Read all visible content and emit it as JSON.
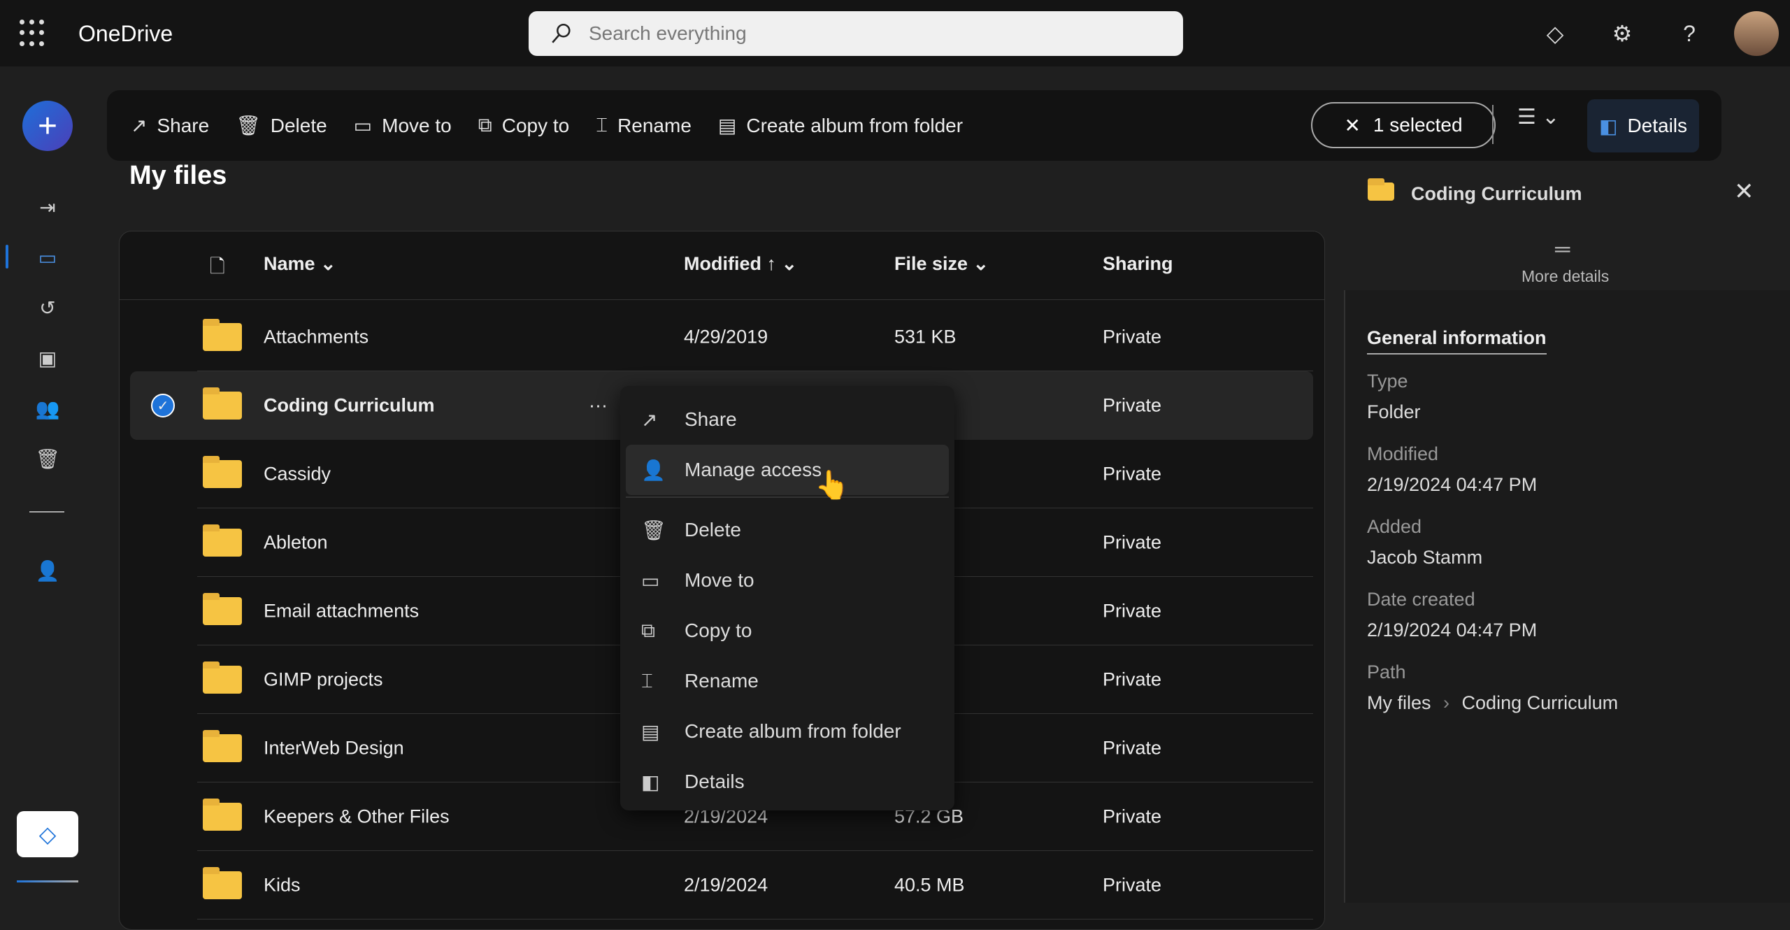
{
  "app": {
    "title": "OneDrive",
    "search_placeholder": "Search everything"
  },
  "header_icons": [
    "premium-diamond-icon",
    "settings-gear-icon",
    "help-icon",
    "avatar"
  ],
  "toolbar": {
    "items": [
      {
        "label": "Share",
        "icon": "share-icon"
      },
      {
        "label": "Delete",
        "icon": "trash-icon"
      },
      {
        "label": "Move to",
        "icon": "move-icon"
      },
      {
        "label": "Copy to",
        "icon": "copy-icon"
      },
      {
        "label": "Rename",
        "icon": "rename-icon"
      },
      {
        "label": "Create album from folder",
        "icon": "album-icon"
      }
    ],
    "selected_label": "1 selected",
    "details_label": "Details"
  },
  "page": {
    "title": "My files"
  },
  "table": {
    "columns": {
      "name": "Name",
      "modified": "Modified",
      "size": "File size",
      "sharing": "Sharing"
    },
    "rows": [
      {
        "name": "Attachments",
        "modified": "4/29/2019",
        "size": "531 KB",
        "sharing": "Private"
      },
      {
        "name": "Coding Curriculum",
        "modified": "",
        "size": "",
        "sharing": "Private",
        "selected": true
      },
      {
        "name": "Cassidy",
        "modified": "",
        "size": "",
        "sharing": "Private"
      },
      {
        "name": "Ableton",
        "modified": "",
        "size": "",
        "sharing": "Private"
      },
      {
        "name": "Email attachments",
        "modified": "",
        "size": "",
        "sharing": "Private"
      },
      {
        "name": "GIMP projects",
        "modified": "",
        "size": "",
        "sharing": "Private"
      },
      {
        "name": "InterWeb Design",
        "modified": "",
        "size": "",
        "sharing": "Private"
      },
      {
        "name": "Keepers & Other Files",
        "modified": "2/19/2024",
        "size": "57.2 GB",
        "sharing": "Private"
      },
      {
        "name": "Kids",
        "modified": "2/19/2024",
        "size": "40.5 MB",
        "sharing": "Private"
      }
    ]
  },
  "context_menu": {
    "items": [
      {
        "label": "Share",
        "icon": "share-icon"
      },
      {
        "label": "Manage access",
        "icon": "manage-access-icon"
      },
      {
        "label": "Delete",
        "icon": "trash-icon"
      },
      {
        "label": "Move to",
        "icon": "move-icon"
      },
      {
        "label": "Copy to",
        "icon": "copy-icon"
      },
      {
        "label": "Rename",
        "icon": "rename-icon"
      },
      {
        "label": "Create album from folder",
        "icon": "album-icon"
      },
      {
        "label": "Details",
        "icon": "details-icon"
      }
    ]
  },
  "details_panel": {
    "title": "Coding Curriculum",
    "more_details": "More details",
    "section": "General information",
    "fields": [
      {
        "label": "Type",
        "value": "Folder"
      },
      {
        "label": "Modified",
        "value": "2/19/2024 04:47 PM"
      },
      {
        "label": "Added",
        "value": "Jacob Stamm"
      },
      {
        "label": "Date created",
        "value": "2/19/2024 04:47 PM"
      },
      {
        "label": "Path",
        "value": "My files",
        "value2": "Coding Curriculum"
      }
    ]
  },
  "colors": {
    "accent": "#1e73d9",
    "folder": "#f6c443",
    "background": "#1f1f1f"
  }
}
